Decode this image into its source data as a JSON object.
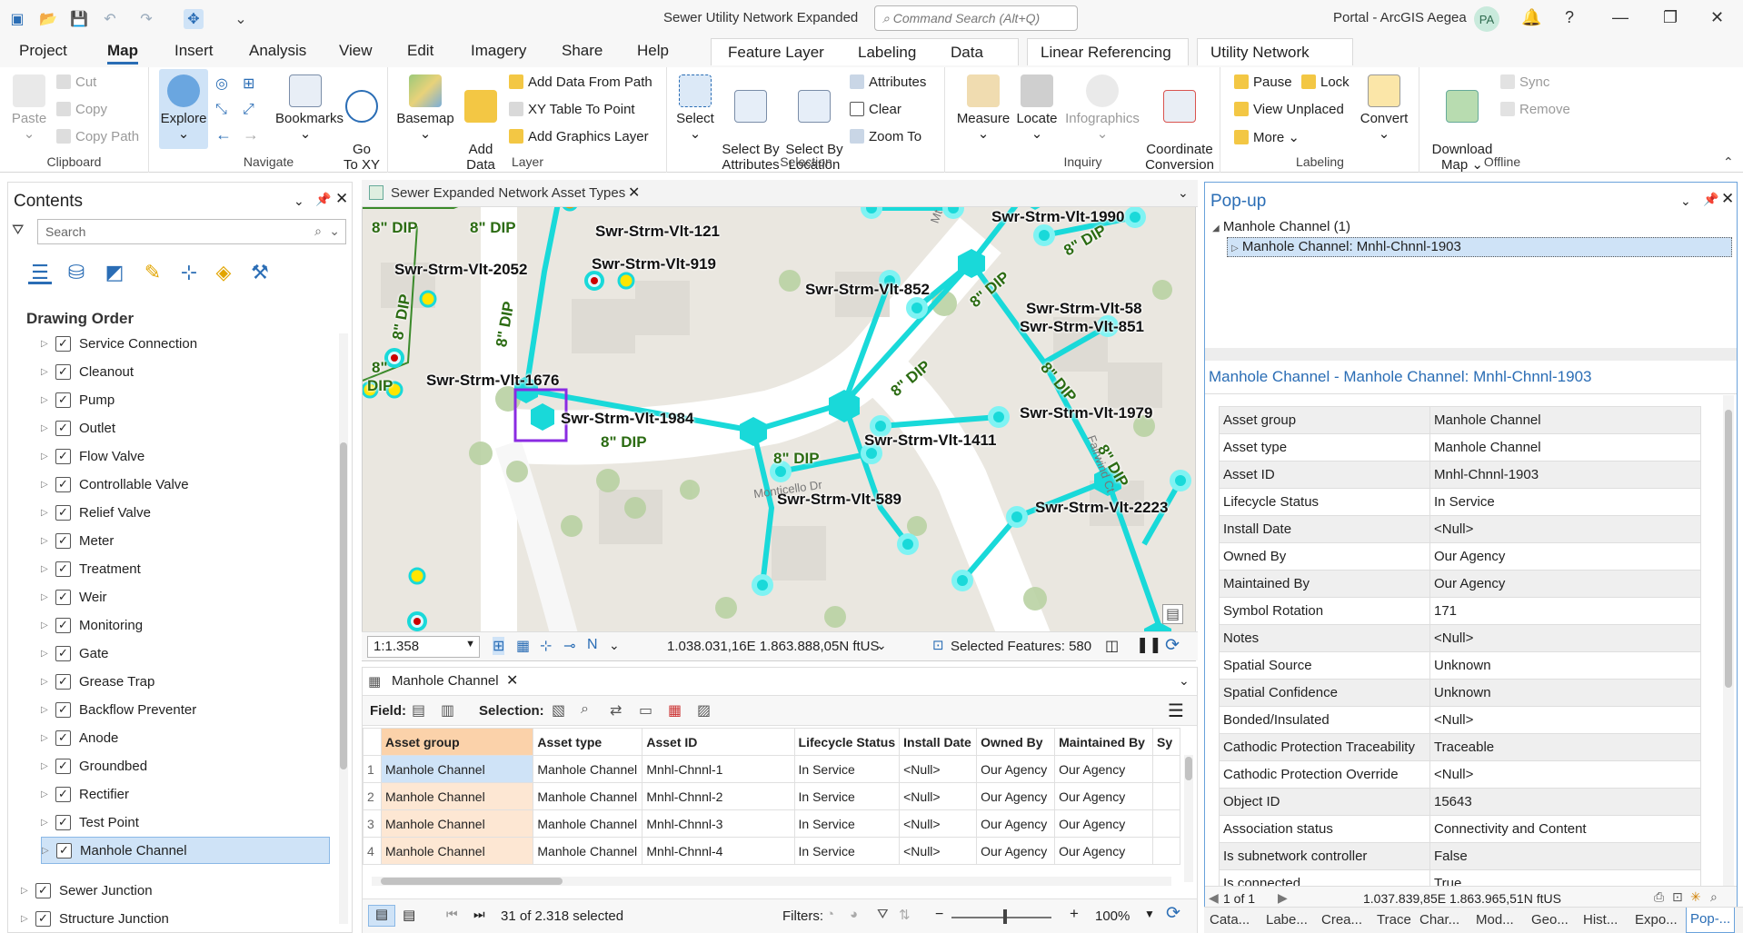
{
  "app": {
    "title": "Sewer Utility Network Expanded",
    "command_search_placeholder": "Command Search (Alt+Q)",
    "portal": "Portal - ArcGIS Aegea",
    "avatar": "PA"
  },
  "menu_tabs": [
    "Project",
    "Map",
    "Insert",
    "Analysis",
    "View",
    "Edit",
    "Imagery",
    "Share",
    "Help"
  ],
  "active_tab": "Map",
  "context_tabs": [
    "Feature Layer",
    "Labeling",
    "Data",
    "Linear Referencing",
    "Utility Network"
  ],
  "ribbon": {
    "clipboard": {
      "label": "Clipboard",
      "paste": "Paste",
      "cut": "Cut",
      "copy": "Copy",
      "copy_path": "Copy Path"
    },
    "navigate": {
      "label": "Navigate",
      "explore": "Explore",
      "bookmarks": "Bookmarks",
      "go_to_xy": "Go\nTo XY"
    },
    "layer": {
      "label": "Layer",
      "basemap": "Basemap",
      "add_data": "Add\nData",
      "add_data_from_path": "Add Data From Path",
      "xy_table": "XY Table To Point",
      "add_graphics": "Add Graphics Layer"
    },
    "selection": {
      "label": "Selection",
      "select": "Select",
      "by_attributes": "Select By\nAttributes",
      "by_location": "Select By\nLocation",
      "attributes": "Attributes",
      "clear": "Clear",
      "zoom_to": "Zoom To"
    },
    "inquiry": {
      "label": "Inquiry",
      "measure": "Measure",
      "locate": "Locate",
      "infographics": "Infographics",
      "coordinate_conversion": "Coordinate\nConversion"
    },
    "labeling": {
      "label": "Labeling",
      "pause": "Pause",
      "lock": "Lock",
      "view_unplaced": "View Unplaced",
      "more": "More",
      "convert": "Convert"
    },
    "offline": {
      "label": "Offline",
      "download_map": "Download\nMap",
      "sync": "Sync",
      "remove": "Remove"
    }
  },
  "contents": {
    "title": "Contents",
    "search_placeholder": "Search",
    "section": "Drawing Order",
    "layers": [
      "Service Connection",
      "Cleanout",
      "Pump",
      "Outlet",
      "Flow Valve",
      "Controllable Valve",
      "Relief Valve",
      "Meter",
      "Treatment",
      "Weir",
      "Monitoring",
      "Gate",
      "Grease Trap",
      "Backflow Preventer",
      "Anode",
      "Groundbed",
      "Rectifier",
      "Test Point",
      "Manhole Channel"
    ],
    "selected_layer": "Manhole Channel",
    "top_layers": [
      "Sewer Junction",
      "Structure Junction"
    ]
  },
  "map": {
    "tab_title": "Sewer Expanded Network Asset Types",
    "labels": [
      "Swr-Strm-Vlt-121",
      "Swr-Strm-Vlt-919",
      "Swr-Strm-Vlt-2052",
      "Swr-Strm-Vlt-1990",
      "Swr-Strm-Vlt-852",
      "Swr-Strm-Vlt-58",
      "Swr-Strm-Vlt-851",
      "Swr-Strm-Vlt-1676",
      "Swr-Strm-Vlt-1984",
      "Swr-Strm-Vlt-1979",
      "Swr-Strm-Vlt-1411",
      "Swr-Strm-Vlt-589",
      "Swr-Strm-Vlt-2223"
    ],
    "pipe_label": "8\" DIP",
    "pipe_size": "8\"",
    "pipe_material": "DIP",
    "street_labels": [
      "Monticello Dr",
      "Fairwind Ct",
      "Mt V"
    ],
    "scale": "1:1.358",
    "coordinates": "1.038.031,16E 1.863.888,05N ftUS",
    "selected_features": "Selected Features: 580",
    "colors": {
      "network": "#19d9d9",
      "selection": "#8a2be2",
      "pipe_label": "#2b6b12"
    }
  },
  "attribute_table": {
    "title": "Manhole Channel",
    "field_label": "Field:",
    "selection_label": "Selection:",
    "columns": [
      "Asset group",
      "Asset type",
      "Asset ID",
      "Lifecycle Status",
      "Install Date",
      "Owned By",
      "Maintained By",
      "Sy"
    ],
    "rows": [
      [
        "1",
        "Manhole Channel",
        "Manhole Channel",
        "Mnhl-Chnnl-1",
        "In Service",
        "<Null>",
        "Our Agency",
        "Our Agency"
      ],
      [
        "2",
        "Manhole Channel",
        "Manhole Channel",
        "Mnhl-Chnnl-2",
        "In Service",
        "<Null>",
        "Our Agency",
        "Our Agency"
      ],
      [
        "3",
        "Manhole Channel",
        "Manhole Channel",
        "Mnhl-Chnnl-3",
        "In Service",
        "<Null>",
        "Our Agency",
        "Our Agency"
      ],
      [
        "4",
        "Manhole Channel",
        "Manhole Channel",
        "Mnhl-Chnnl-4",
        "In Service",
        "<Null>",
        "Our Agency",
        "Our Agency"
      ]
    ],
    "selected_count": "31 of 2.318 selected",
    "filters_label": "Filters:",
    "zoom": "100%"
  },
  "popup": {
    "title": "Pop-up",
    "group": "Manhole Channel  (1)",
    "item": "Manhole Channel: Mnhl-Chnnl-1903",
    "header": "Manhole Channel - Manhole Channel: Mnhl-Chnnl-1903",
    "fields": [
      [
        "Asset group",
        "Manhole Channel"
      ],
      [
        "Asset type",
        "Manhole Channel"
      ],
      [
        "Asset ID",
        "Mnhl-Chnnl-1903"
      ],
      [
        "Lifecycle Status",
        "In Service"
      ],
      [
        "Install Date",
        "<Null>"
      ],
      [
        "Owned By",
        "Our Agency"
      ],
      [
        "Maintained By",
        "Our Agency"
      ],
      [
        "Symbol Rotation",
        "171"
      ],
      [
        "Notes",
        "<Null>"
      ],
      [
        "Spatial Source",
        "Unknown"
      ],
      [
        "Spatial Confidence",
        "Unknown"
      ],
      [
        "Bonded/Insulated",
        "<Null>"
      ],
      [
        "Cathodic Protection Traceability",
        "Traceable"
      ],
      [
        "Cathodic Protection Override",
        "<Null>"
      ],
      [
        "Object ID",
        "15643"
      ],
      [
        "Association status",
        "Connectivity and Content"
      ],
      [
        "Is subnetwork controller",
        "False"
      ],
      [
        "Is connected",
        "True"
      ]
    ],
    "pager": "1 of 1",
    "coordinates": "1.037.839,85E 1.863.965,51N ftUS"
  },
  "bottom_tabs": [
    "Cata...",
    "Labe...",
    "Crea...",
    "Trace",
    "Char...",
    "Mod...",
    "Geo...",
    "Hist...",
    "Expo...",
    "Pop-..."
  ]
}
